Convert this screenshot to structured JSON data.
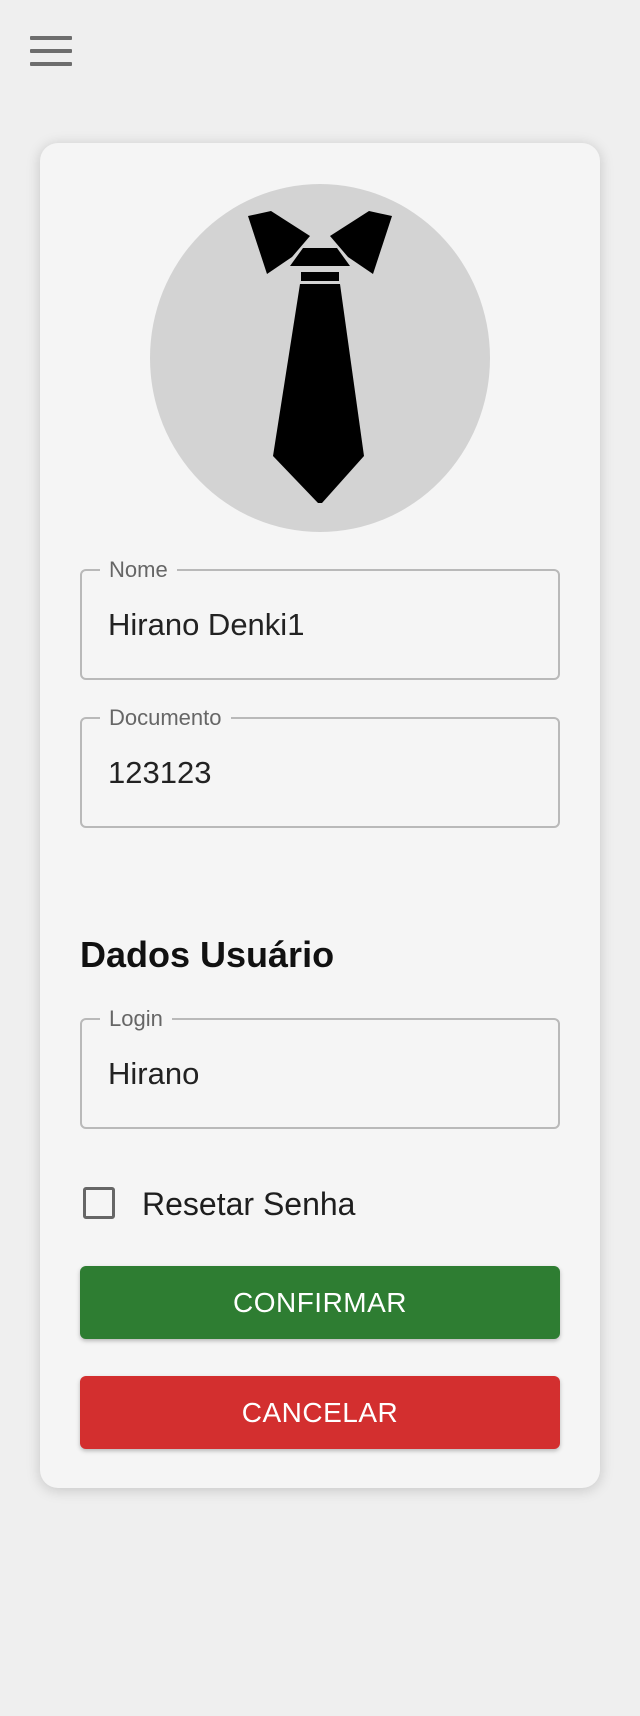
{
  "menu": {
    "icon": "hamburger-menu-icon"
  },
  "profile": {
    "avatar_icon": "necktie-icon"
  },
  "fields": {
    "nome": {
      "label": "Nome",
      "value": "Hirano Denki1"
    },
    "documento": {
      "label": "Documento",
      "value": "123123"
    },
    "login": {
      "label": "Login",
      "value": "Hirano"
    }
  },
  "section": {
    "title": "Dados Usuário"
  },
  "reset_password": {
    "label": "Resetar Senha",
    "checked": false
  },
  "buttons": {
    "confirm": "CONFIRMAR",
    "cancel": "CANCELAR"
  },
  "colors": {
    "page_background": "#efefef",
    "card_background": "#f5f5f5",
    "confirm": "#2e7d32",
    "cancel": "#d32f2f",
    "avatar_background": "#d3d3d3"
  }
}
